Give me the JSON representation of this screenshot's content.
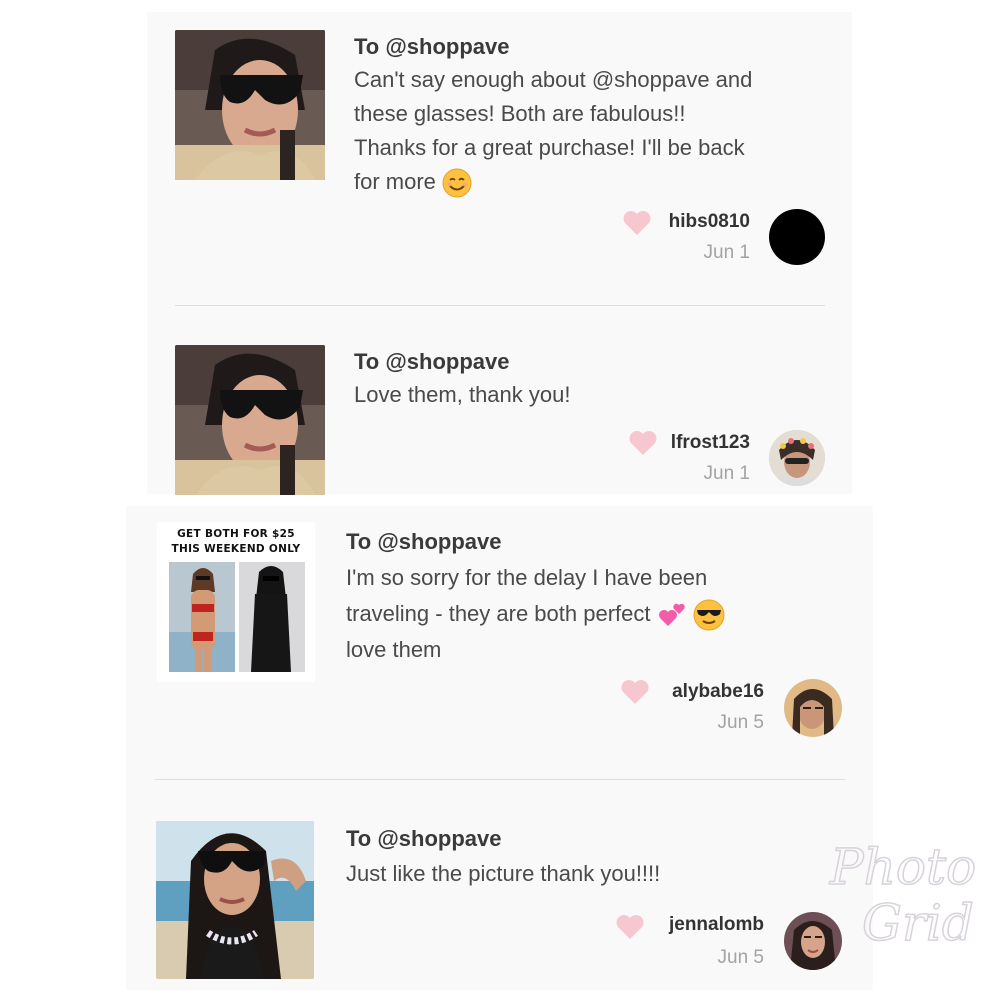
{
  "reviews": [
    {
      "to": "To @shoppave",
      "lines": [
        "Can't say enough about @shoppave and",
        "these glasses! Both are fabulous!!",
        "Thanks for a great purchase! I'll be back",
        "for more"
      ],
      "emoji": "smiling-face-emoji",
      "username": "hibs0810",
      "date": "Jun 1"
    },
    {
      "to": "To @shoppave",
      "lines": [
        "Love them, thank you!"
      ],
      "username": "lfrost123",
      "date": "Jun 1"
    },
    {
      "to": "To @shoppave",
      "lines": [
        "I'm so sorry for the delay I have been",
        "traveling - they are both perfect",
        "love them"
      ],
      "emoji": "two-hearts-emoji sunglasses-face-emoji",
      "promo_line1": "GET BOTH FOR $25",
      "promo_line2": "THIS WEEKEND ONLY",
      "username": "alybabe16",
      "date": "Jun 5"
    },
    {
      "to": "To @shoppave",
      "lines": [
        "Just like the picture thank you!!!!"
      ],
      "username": "jennalomb",
      "date": "Jun 5"
    }
  ],
  "watermark": "PhotoGrid",
  "colors": {
    "heart": "#f7c7cf",
    "panel": "#faf9fa",
    "divider": "#dedede",
    "date": "#a3a3a3"
  }
}
